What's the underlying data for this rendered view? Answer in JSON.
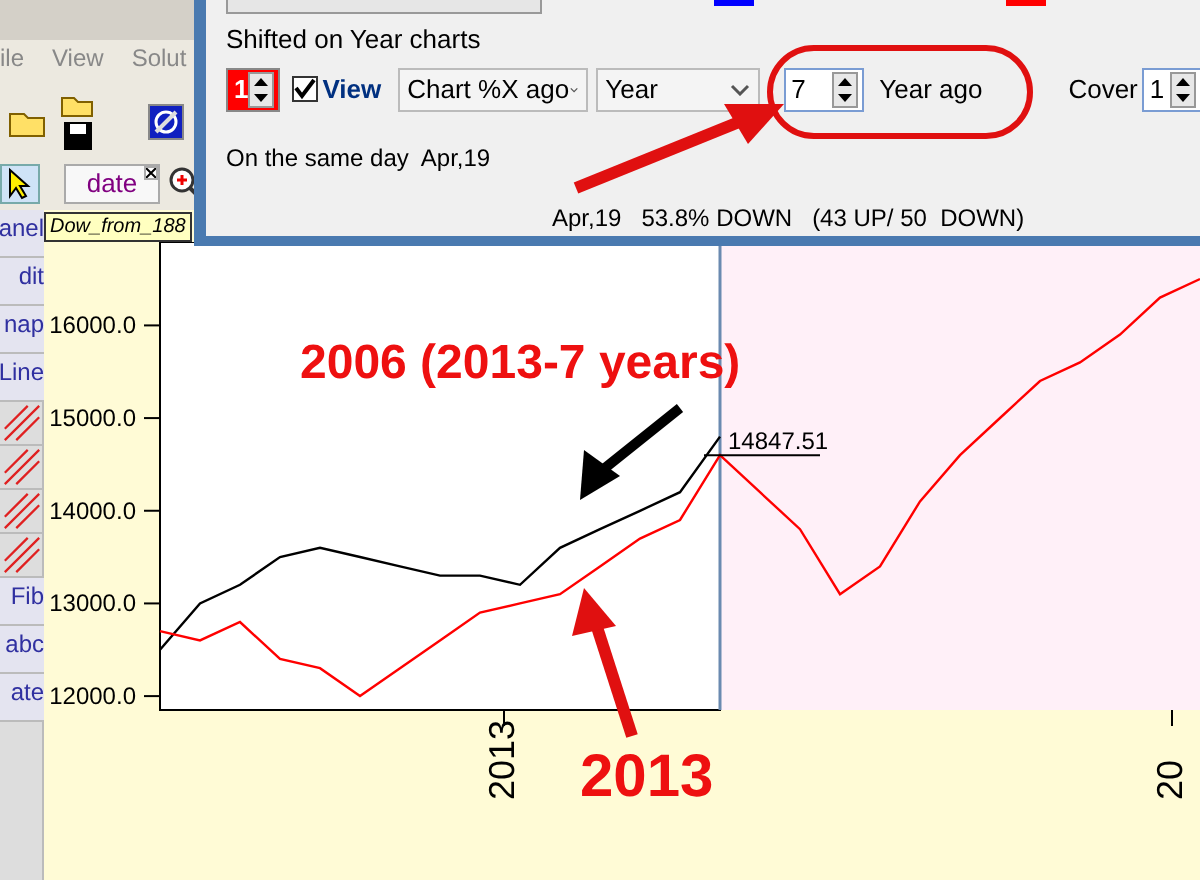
{
  "app": {
    "menu": [
      "ile",
      "View",
      "Solut"
    ],
    "tabs": [
      {
        "label": "date",
        "selected": true
      }
    ],
    "side_tools": [
      "anel",
      "dit",
      "nap",
      "Line",
      "Fib",
      "abc",
      "ate"
    ],
    "chart_title": "Dow_from_188"
  },
  "dialog": {
    "swatches": [
      {
        "color": "#0000ff"
      },
      {
        "color": "#ff0000"
      }
    ],
    "group_title": "Shifted on Year charts",
    "offset_spin": "1",
    "view": {
      "label": "View",
      "checked": true
    },
    "mode_select": "Chart %X ago",
    "unit_select": "Year",
    "years_spin": "7",
    "years_label": "Year ago",
    "cover_label": "Cover",
    "cover_spin": "1",
    "same_day": "On the same day  Apr,19",
    "result": {
      "date": "Apr,19",
      "percent": "53.8% DOWN",
      "counts": "(43 UP/ 50  DOWN)"
    }
  },
  "chart": {
    "price_label": "14847.51",
    "chart_data": {
      "type": "line",
      "annotations": [
        "2013",
        "20"
      ],
      "ylim": [
        11850,
        16900
      ],
      "yticks": [
        {
          "value": 12000,
          "label": "12000.0"
        },
        {
          "value": 13000,
          "label": "13000.0"
        },
        {
          "value": 14000,
          "label": "14000.0"
        },
        {
          "value": 15000,
          "label": "15000.0"
        },
        {
          "value": 16000,
          "label": "16000.0"
        }
      ],
      "series": [
        {
          "color": "#000000",
          "values": [
            12500,
            13000,
            13200,
            13500,
            13600,
            13500,
            13400,
            13300,
            13300,
            13200,
            13600,
            13800,
            14000,
            14200,
            14800,
            null,
            null,
            null,
            null,
            null,
            null,
            null,
            null,
            null,
            null,
            null,
            null
          ]
        },
        {
          "color": "#ff0000",
          "values": [
            12700,
            12600,
            12800,
            12400,
            12300,
            12000,
            12300,
            12600,
            12900,
            13000,
            13100,
            13400,
            13700,
            13900,
            14600,
            14200,
            13800,
            13100,
            13400,
            14100,
            14600,
            15000,
            15400,
            15600,
            15900,
            16300,
            16500
          ]
        }
      ]
    }
  },
  "annotations": [
    {
      "kind": "text",
      "text": "2006 (2013-7 years)"
    },
    {
      "kind": "text",
      "text": "2013"
    }
  ]
}
